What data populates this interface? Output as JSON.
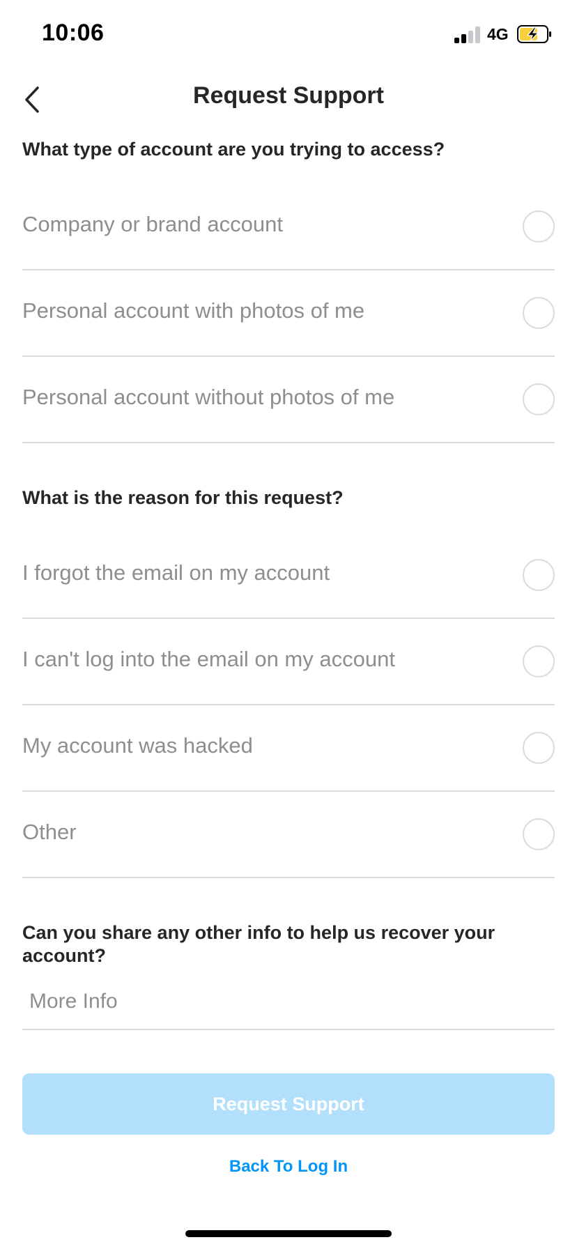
{
  "status_bar": {
    "time": "10:06",
    "network": "4G",
    "signal_bars_active": 2,
    "signal_bars_total": 4,
    "battery_state": "charging",
    "battery_color": "#f7cf3b"
  },
  "header": {
    "title": "Request Support",
    "back_icon": "chevron-left-icon"
  },
  "account_type": {
    "question": "What type of account are you trying to access?",
    "options": [
      {
        "label": "Company or brand account",
        "selected": false
      },
      {
        "label": "Personal account with photos of me",
        "selected": false
      },
      {
        "label": "Personal account without photos of me",
        "selected": false
      }
    ]
  },
  "reason": {
    "question": "What is the reason for this request?",
    "options": [
      {
        "label": "I forgot the email on my account",
        "selected": false
      },
      {
        "label": "I can't log into the email on my account",
        "selected": false
      },
      {
        "label": "My account was hacked",
        "selected": false
      },
      {
        "label": "Other",
        "selected": false
      }
    ]
  },
  "extra_info": {
    "question": "Can you share any other info to help us recover your account?",
    "placeholder": "More Info",
    "value": ""
  },
  "actions": {
    "submit_label": "Request Support",
    "submit_enabled": false,
    "back_link_label": "Back To Log In"
  },
  "colors": {
    "accent": "#0095f6",
    "button_disabled": "#b2dffc",
    "divider": "#dbdbdb",
    "muted_text": "#8e8e8e",
    "primary_text": "#262626"
  }
}
